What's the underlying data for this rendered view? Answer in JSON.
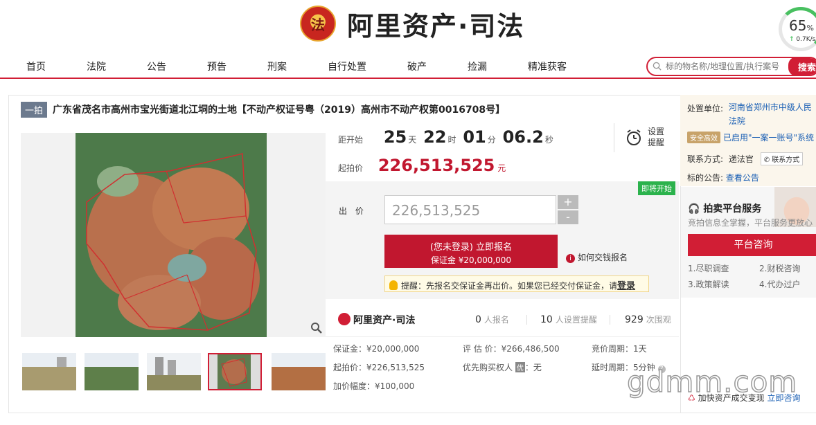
{
  "brand": {
    "emblem_char": "法",
    "name": "阿里资产·司法"
  },
  "speed_widget": {
    "percent": "65",
    "percent_sign": "%",
    "rate": "0.7K/s"
  },
  "nav": {
    "items": [
      "首页",
      "法院",
      "公告",
      "预告",
      "刑案",
      "自行处置",
      "破产",
      "捡漏",
      "精准获客"
    ]
  },
  "search": {
    "placeholder": "标的物名称/地理位置/执行案号",
    "button": "搜索"
  },
  "listing": {
    "tag": "一拍",
    "title": "广东省茂名市高州市宝光街道北江垌的土地【不动产权证号粤（2019）高州市不动产权第0016708号】"
  },
  "countdown": {
    "label": "距开始",
    "days": "25",
    "days_unit": "天",
    "hours": "22",
    "hours_unit": "时",
    "minutes": "01",
    "minutes_unit": "分",
    "seconds": "06.2",
    "seconds_unit": "秒",
    "remind_label": "设置\n提醒"
  },
  "start_price": {
    "label": "起拍价",
    "value": "226,513,525",
    "unit": "元"
  },
  "bid": {
    "badge": "即将开始",
    "label": "出 价",
    "value": "226,513,525",
    "plus": "+",
    "minus": "-",
    "signup_line1": "(您未登录) 立即报名",
    "signup_line2": "保证金 ¥20,000,000",
    "howto": "如何交钱报名",
    "tip_text": "提醒：先报名交保证金再出价。如果您已经交付保证金，请",
    "tip_link": "登录"
  },
  "stats": {
    "logo": "阿里资产·司法",
    "signups": "0",
    "signups_label": "人报名",
    "reminders": "10",
    "reminders_label": "人设置提醒",
    "views": "929",
    "views_label": "次围观"
  },
  "details": {
    "deposit": "保证金：¥20,000,000",
    "start_price": "起拍价：¥226,513,525",
    "increment": "加价幅度：¥100,000",
    "appraisal": "评 估 价：¥266,486,500",
    "priority": "优先购买权人",
    "priority_badge": "优",
    "priority_value": "：无",
    "period": "竞价周期：1天",
    "extension": "延时周期：5分钟"
  },
  "sidebar": {
    "court_label": "处置单位:",
    "court_name": "河南省郑州市中级人民法院",
    "safe_badge": "安全高效",
    "safe_text": "已启用\"一案一账号\"系统",
    "contact_label": "联系方式:",
    "contact_name": "递法官",
    "contact_btn": "联系方式",
    "notice_label": "标的公告:",
    "notice_link": "查看公告",
    "promo_title": "拍卖平台服务",
    "promo_sub": "竞拍信息全掌握，平台服务更放心",
    "consult_button": "平台咨询",
    "services": [
      "1.尽职调查",
      "2.财税咨询",
      "3.政策解读",
      "4.代办过户"
    ],
    "bottom_text": "加快资产成交变现",
    "bottom_link": "立即咨询"
  },
  "watermark": "gdmm.com"
}
